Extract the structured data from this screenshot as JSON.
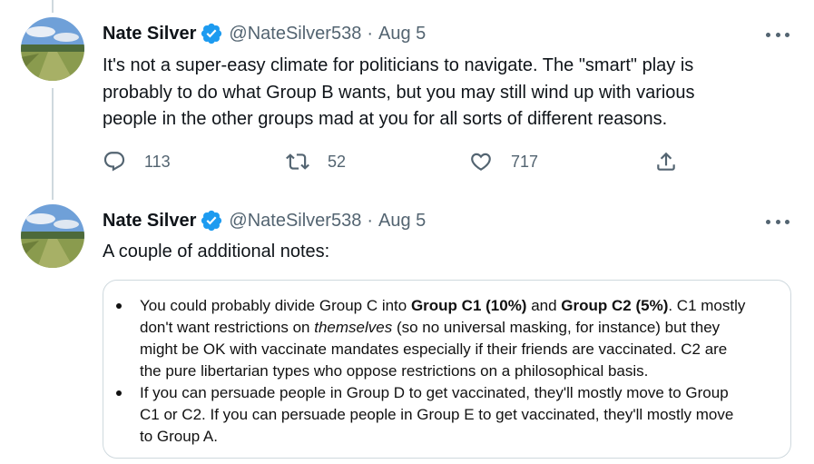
{
  "colors": {
    "text_primary": "#0f1419",
    "text_secondary": "#536471",
    "verified_blue": "#1d9bf0",
    "divider": "#cfd9de"
  },
  "tweets": [
    {
      "author": {
        "name": "Nate Silver",
        "handle": "@NateSilver538",
        "verified": true,
        "avatar_icon": "field-landscape-avatar"
      },
      "separator": "·",
      "date": "Aug 5",
      "text_lines": [
        "It's not a super-easy climate for politicians to navigate. The \"smart\" play is",
        "probably to do what Group B wants, but you may still wind up with various",
        "people in the other groups mad at you for all sorts of different reasons."
      ],
      "actions": {
        "reply_count": "113",
        "retweet_count": "52",
        "like_count": "717"
      }
    },
    {
      "author": {
        "name": "Nate Silver",
        "handle": "@NateSilver538",
        "verified": true,
        "avatar_icon": "field-landscape-avatar"
      },
      "separator": "·",
      "date": "Aug 5",
      "text_lines": [
        "A couple of additional notes:"
      ],
      "media_bullets": [
        {
          "lines": [
            [
              "You could probably divide Group C into ",
              "Group C1 (10%)",
              " and ",
              "Group C2 (5%)",
              ". C1 mostly"
            ],
            [
              "don't want restrictions on ",
              "themselves",
              " (so no universal masking, for instance) but they"
            ],
            [
              "might be OK with vaccinate mandates especially if their friends are vaccinated. C2 are"
            ],
            [
              "the pure libertarian types who oppose restrictions on a philosophical basis."
            ]
          ]
        },
        {
          "lines": [
            [
              "If you can persuade people in Group D to get vaccinated, they'll mostly move to Group"
            ],
            [
              "C1 or C2. If you can persuade people in Group E to get vaccinated, they'll mostly move"
            ],
            [
              "to Group A."
            ]
          ]
        }
      ]
    }
  ]
}
